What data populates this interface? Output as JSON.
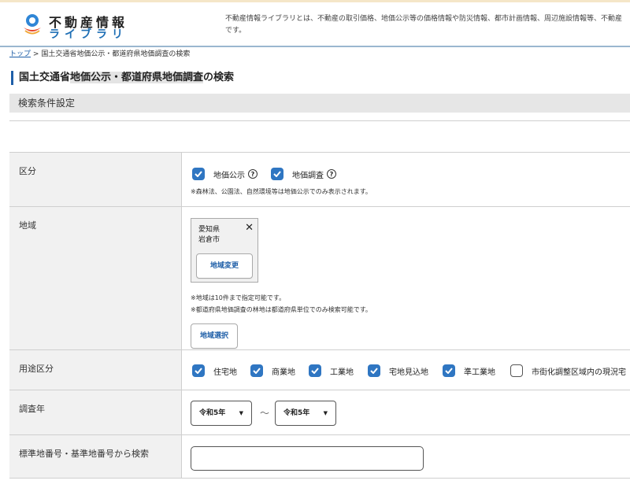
{
  "header": {
    "logo_line1": "不動産情報",
    "logo_line2": "ライブラリ",
    "description_line1": "不動産情報ライブラリとは、不動産の取引価格、地価公示等の価格情報や防災情報、都市計画情報、周辺施設情報等、不動産",
    "description_line2": "です。"
  },
  "breadcrumb": {
    "home": "トップ",
    "separator": ">",
    "current": "国土交通省地価公示・都道府県地価調査の検索"
  },
  "page": {
    "title_prefix": "国土交通省",
    "title_highlight": "地価公示・都道府県地価調査",
    "title_suffix": "の検索",
    "section_title": "検索条件設定"
  },
  "form": {
    "category": {
      "label": "区分",
      "options": [
        {
          "label": "地価公示",
          "checked": true
        },
        {
          "label": "地価調査",
          "checked": true
        }
      ],
      "help_symbol": "?",
      "note": "※森林法、公園法、自然環境等は地価公示でのみ表示されます。"
    },
    "region": {
      "label": "地域",
      "selected_pref": "愛知県",
      "selected_city": "岩倉市",
      "remove_symbol": "✕",
      "change_button": "地域変更",
      "note1": "※地域は10件まで指定可能です。",
      "note2": "※都道府県地価調査の林地は都道府県単位でのみ検索可能です。",
      "select_button": "地域選択"
    },
    "usage": {
      "label": "用途区分",
      "options": [
        {
          "label": "住宅地",
          "checked": true
        },
        {
          "label": "商業地",
          "checked": true
        },
        {
          "label": "工業地",
          "checked": true
        },
        {
          "label": "宅地見込地",
          "checked": true
        },
        {
          "label": "準工業地",
          "checked": true
        },
        {
          "label": "市街化調整区域内の現況宅",
          "checked": false
        }
      ]
    },
    "survey_year": {
      "label": "調査年",
      "from_value": "令和5年",
      "to_value": "令和5年",
      "range_separator": "～"
    },
    "lot_number": {
      "label": "標準地番号・基準地番号から検索",
      "value": ""
    }
  },
  "colors": {
    "accent": "#2f76c2",
    "link": "#1f5fa8",
    "label_bg": "#f1f1f1",
    "section_bg": "#e6e6e6"
  }
}
